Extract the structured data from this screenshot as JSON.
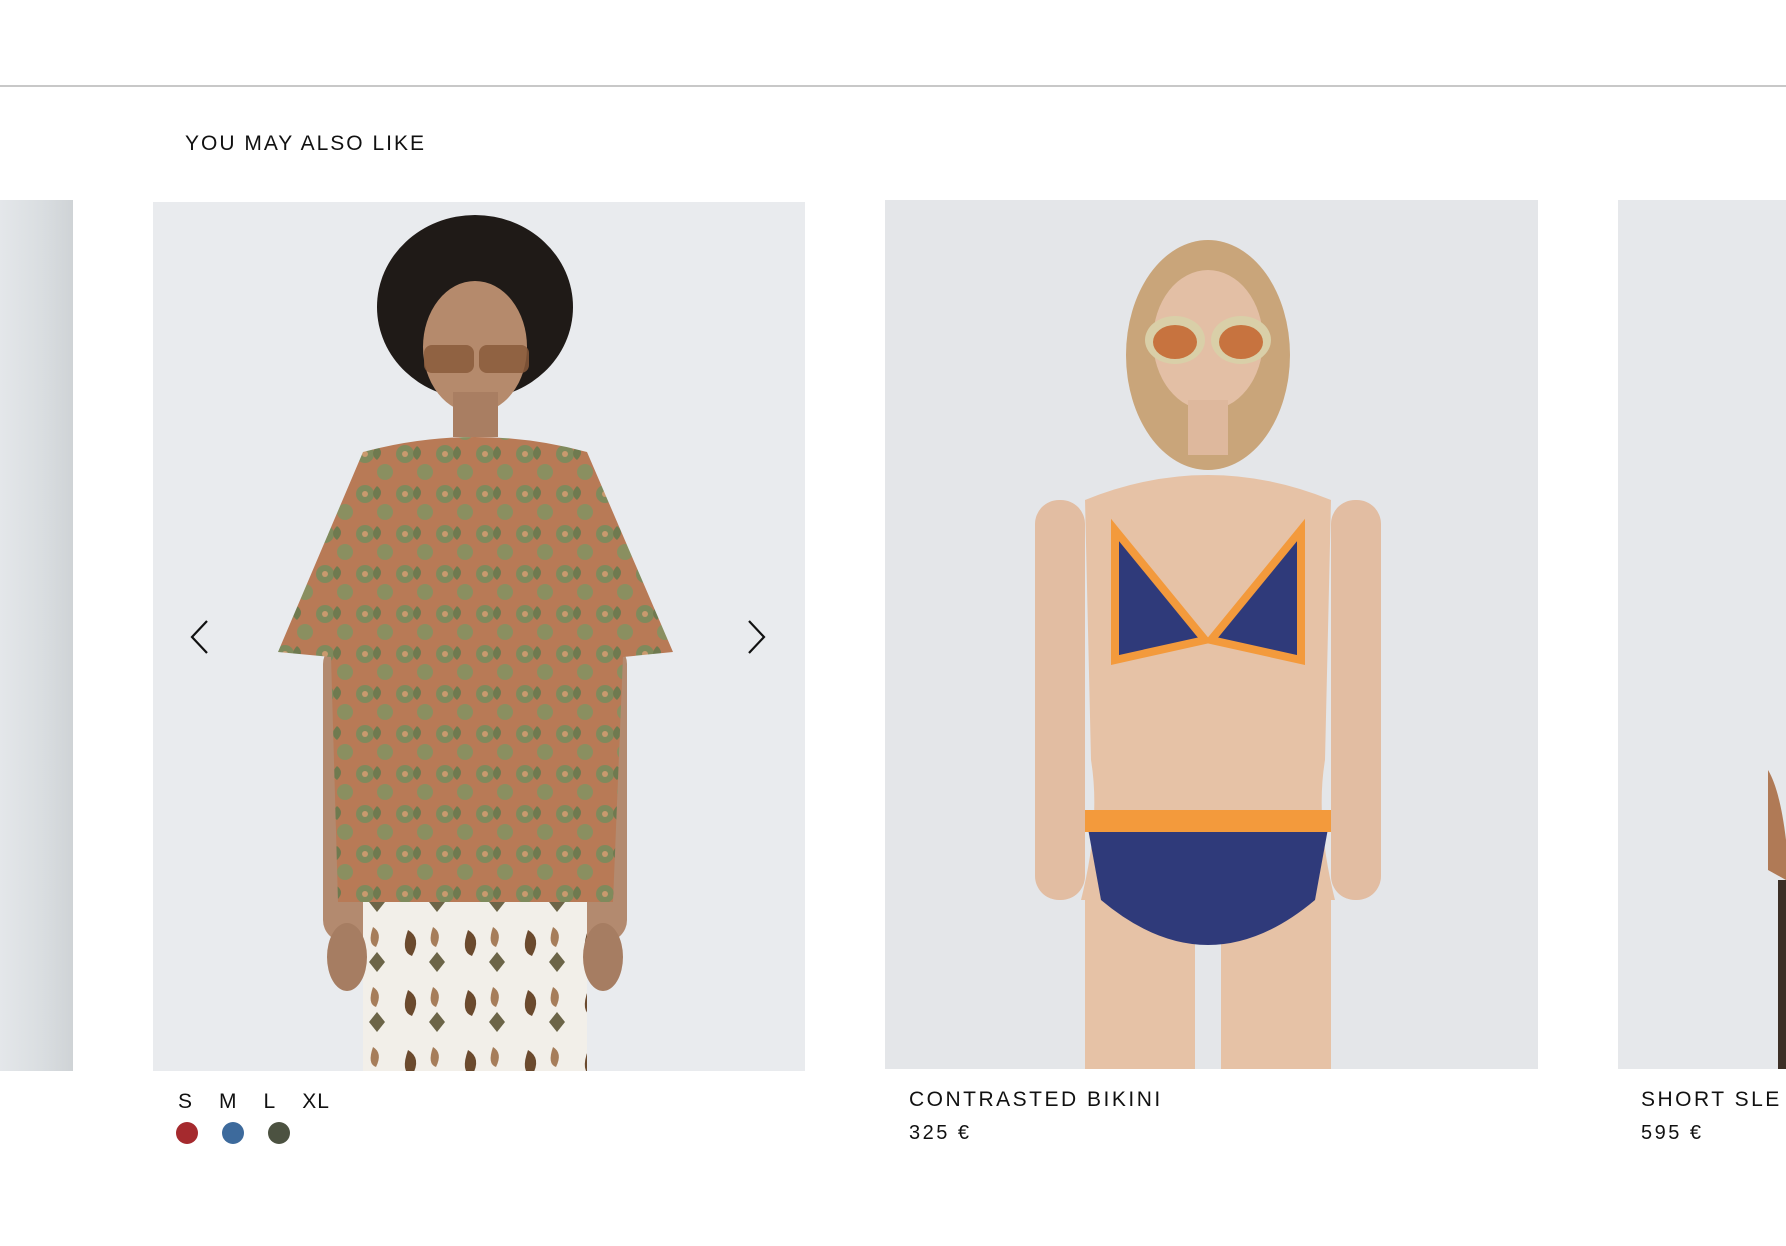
{
  "section": {
    "title": "YOU MAY ALSO LIKE"
  },
  "products": [
    {
      "sizes": [
        "S",
        "M",
        "L",
        "XL"
      ],
      "swatches": [
        {
          "name": "red",
          "color": "#a52a2e"
        },
        {
          "name": "blue",
          "color": "#3d6a9c"
        },
        {
          "name": "olive",
          "color": "#4c5241"
        }
      ]
    },
    {
      "name": "CONTRASTED BIKINI",
      "price": "325 €"
    },
    {
      "name": "SHORT SLE",
      "price": "595 €"
    }
  ],
  "icons": {
    "prev": "chevron-left-icon",
    "next": "chevron-right-icon"
  }
}
